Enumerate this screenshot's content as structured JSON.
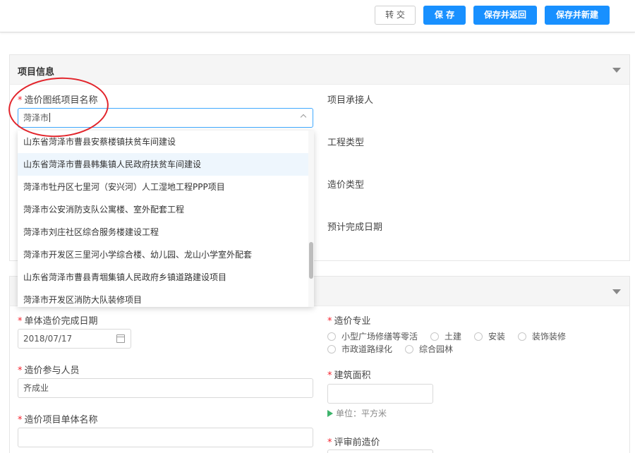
{
  "toolbar": {
    "transfer_label": "转 交",
    "save_label": "保 存",
    "save_return_label": "保存并返回",
    "save_new_label": "保存并新建"
  },
  "project_panel": {
    "title": "项目信息",
    "name_label": "造价图纸项目名称",
    "name_value": "菏泽市",
    "contractor_label": "项目承接人",
    "engineering_type_label": "工程类型",
    "cost_type_label": "造价类型",
    "due_date_label": "预计完成日期"
  },
  "dropdown_items": [
    "山东省菏泽市曹县安蔡楼镇扶贫车间建设",
    "山东省菏泽市曹县韩集镇人民政府扶贫车间建设",
    "菏泽市牡丹区七里河（安兴河）人工湿地工程PPP项目",
    "菏泽市公安消防支队公寓楼、室外配套工程",
    "菏泽市刘庄社区综合服务楼建设工程",
    "菏泽市开发区三里河小学综合楼、幼儿园、龙山小学室外配套",
    "山东省菏泽市曹县青堌集镇人民政府乡镇道路建设项目",
    "菏泽市开发区消防大队装修项目"
  ],
  "unit_panel": {
    "complete_date_label": "单体造价完成日期",
    "complete_date_value": "2018/07/17",
    "participants_label": "造价参与人员",
    "participants_value": "齐成业",
    "unit_name_label": "造价项目单体名称",
    "unit_name_value": "",
    "specialty_label": "造价专业",
    "specialty_options": [
      "小型广场修缮等零活",
      "土建",
      "安装",
      "装饰装修",
      "市政道路绿化",
      "综合园林"
    ],
    "area_label": "建筑面积",
    "area_value": "",
    "area_hint": "单位：平方米",
    "pre_review_label": "评审前造价"
  },
  "colors": {
    "primary": "#1890ff",
    "required": "#f5222d",
    "annotation": "#e2242b"
  }
}
